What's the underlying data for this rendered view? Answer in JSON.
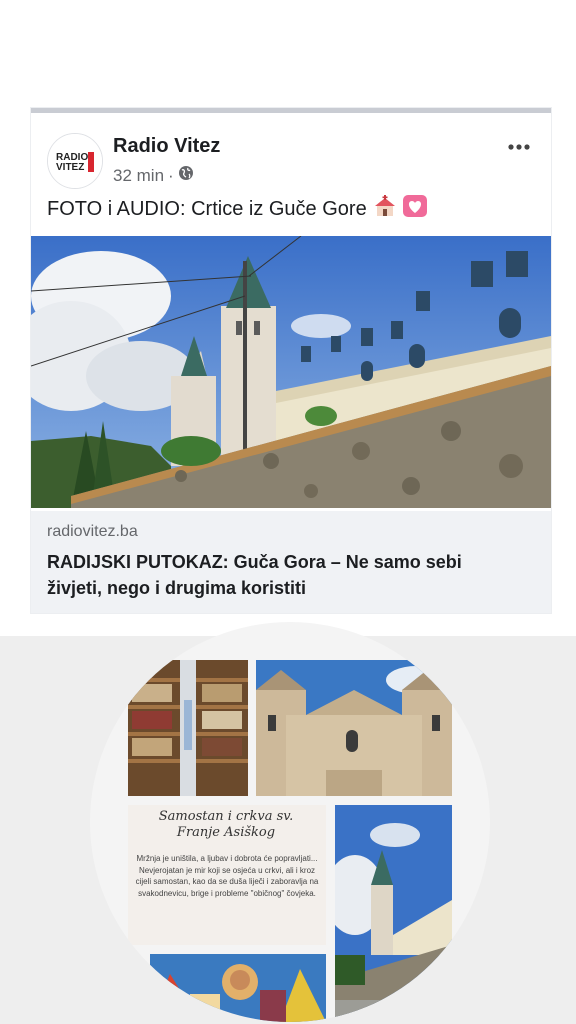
{
  "post": {
    "page_name": "Radio Vitez",
    "time": "32 min",
    "separator": "·",
    "caption": "FOTO i AUDIO: Crtice iz Guče Gore",
    "caption_emojis": [
      "church-emoji",
      "heart-emoji"
    ],
    "avatar_logo_text": "RADIO VITEZ"
  },
  "link": {
    "domain": "radiovitez.ba",
    "title": "RADIJSKI PUTOKAZ: Guča Gora – Ne samo sebi živjeti, nego i drugima koristiti"
  },
  "collage": {
    "card_title": "Samostan i crkva sv. Franje Asiškog",
    "card_text": "Mržnja je uništila, a ljubav i dobrota će popravljati... Nevjerojatan je mir koji se osjeća u crkvi, ali i kroz cijeli samostan, kao da se duša liječi i zaboravlja na svakodnevicu, brige i probleme \"običnog\" čovjeka."
  },
  "colors": {
    "text_primary": "#1c1e21",
    "text_secondary": "#65676b",
    "link_bg": "#f0f2f5",
    "accent_pink": "#f06a99"
  }
}
